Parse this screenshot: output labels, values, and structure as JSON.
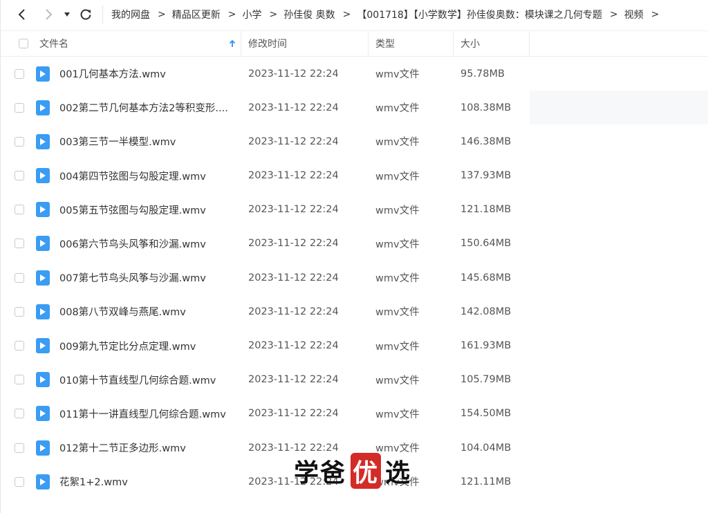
{
  "breadcrumb": [
    "我的网盘",
    "精品区更新",
    "小学",
    "孙佳俊 奥数",
    "【001718】【小学数学】孙佳俊奥数：模块课之几何专题",
    "视频"
  ],
  "breadcrumb_sep": ">",
  "header": {
    "name": "文件名",
    "time": "修改时间",
    "type": "类型",
    "size": "大小",
    "sort_icon": "sort-up-arrow"
  },
  "files": [
    {
      "name": "001几何基本方法.wmv",
      "time": "2023-11-12 22:24",
      "type": "wmv文件",
      "size": "95.78MB"
    },
    {
      "name": "002第二节几何基本方法2等积变形....",
      "time": "2023-11-12 22:24",
      "type": "wmv文件",
      "size": "108.38MB"
    },
    {
      "name": "003第三节一半模型.wmv",
      "time": "2023-11-12 22:24",
      "type": "wmv文件",
      "size": "146.38MB"
    },
    {
      "name": "004第四节弦图与勾股定理.wmv",
      "time": "2023-11-12 22:24",
      "type": "wmv文件",
      "size": "137.93MB"
    },
    {
      "name": "005第五节弦图与勾股定理.wmv",
      "time": "2023-11-12 22:24",
      "type": "wmv文件",
      "size": "121.18MB"
    },
    {
      "name": "006第六节鸟头风筝和沙漏.wmv",
      "time": "2023-11-12 22:24",
      "type": "wmv文件",
      "size": "150.64MB"
    },
    {
      "name": "007第七节鸟头风筝与沙漏.wmv",
      "time": "2023-11-12 22:24",
      "type": "wmv文件",
      "size": "145.68MB"
    },
    {
      "name": "008第八节双峰与燕尾.wmv",
      "time": "2023-11-12 22:24",
      "type": "wmv文件",
      "size": "142.08MB"
    },
    {
      "name": "009第九节定比分点定理.wmv",
      "time": "2023-11-12 22:24",
      "type": "wmv文件",
      "size": "161.93MB"
    },
    {
      "name": "010第十节直线型几何综合题.wmv",
      "time": "2023-11-12 22:24",
      "type": "wmv文件",
      "size": "105.79MB"
    },
    {
      "name": "011第十一讲直线型几何综合题.wmv",
      "time": "2023-11-12 22:24",
      "type": "wmv文件",
      "size": "154.50MB"
    },
    {
      "name": "012第十二节正多边形.wmv",
      "time": "2023-11-12 22:24",
      "type": "wmv文件",
      "size": "104.04MB"
    },
    {
      "name": "花絮1+2.wmv",
      "time": "2023-11-12 22:24",
      "type": "wmv文件",
      "size": "121.11MB"
    }
  ],
  "watermark": {
    "a": "学爸",
    "b": "优",
    "c": "选"
  },
  "colors": {
    "file_icon": "#3a9cf3",
    "sort_arrow": "#2f8ef0",
    "watermark_red": "#d32b27"
  }
}
